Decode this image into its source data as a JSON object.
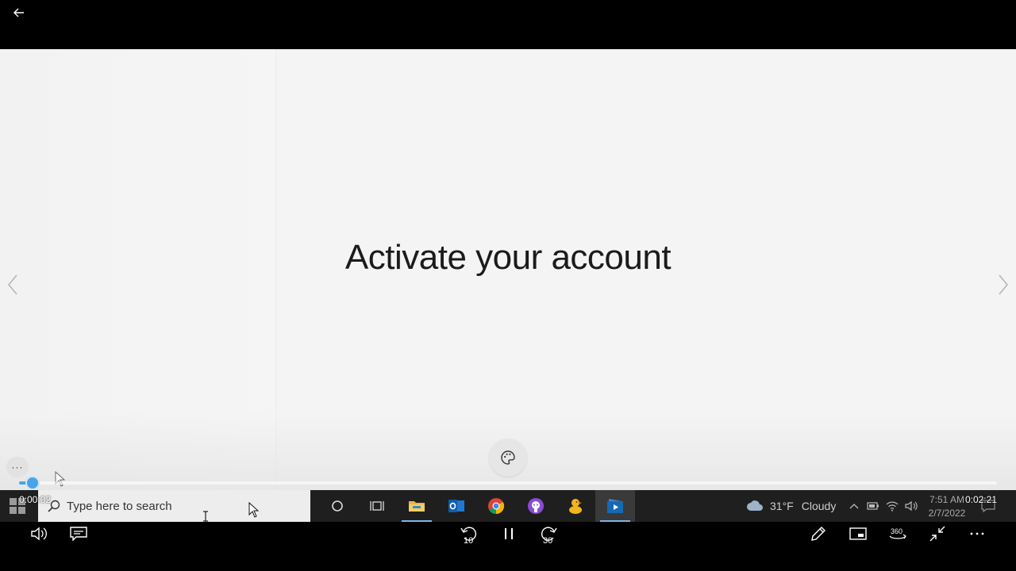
{
  "player": {
    "elapsed": "0:00:02",
    "duration": "0:02:21",
    "progress": 0.014,
    "skip_back_seconds": "10",
    "skip_forward_seconds": "30"
  },
  "slide": {
    "title": "Activate your account"
  },
  "taskbar": {
    "search_placeholder": "Type here to search",
    "weather_temp": "31°F",
    "weather_condition": "Cloudy",
    "time": "7:51 AM",
    "date": "2/7/2022"
  },
  "controls": {
    "menu_dots": "···"
  },
  "colors": {
    "accent": "#4aa3e6",
    "slide_bg": "#f4f4f4",
    "chrome_bg": "#000000"
  }
}
